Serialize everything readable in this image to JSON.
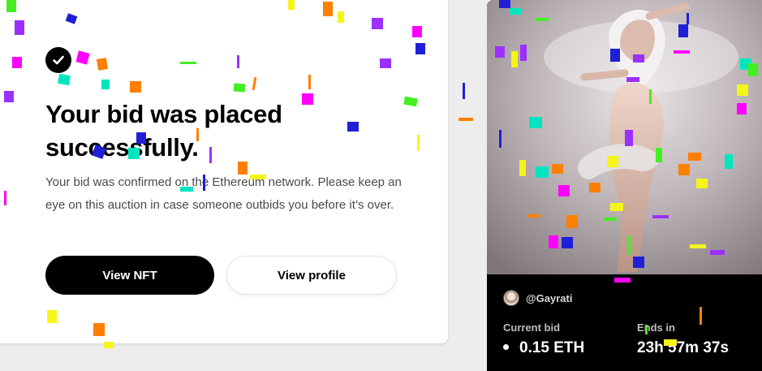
{
  "confirmation": {
    "title": "Your bid was placed successfully.",
    "message": "Your bid was confirmed on the Ethereum network. Please keep an eye on this auction in case someone outbids you before it’s over.",
    "view_nft_label": "View NFT",
    "view_profile_label": "View profile"
  },
  "nft": {
    "creator": "@Gayrati",
    "current_bid_label": "Current bid",
    "current_bid_value": "0.15 ETH",
    "ends_in_label": "Ends in",
    "ends_in_value": "23h 57m 37s"
  },
  "colors": {
    "confetti": [
      "#ff7f00",
      "#1f1fd6",
      "#ff00ff",
      "#9b30ff",
      "#00e5c0",
      "#f5f51a",
      "#44ee22"
    ]
  }
}
